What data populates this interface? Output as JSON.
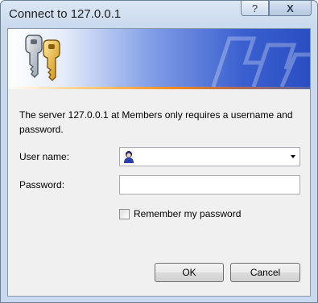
{
  "window": {
    "title": "Connect to 127.0.0.1",
    "help_label": "?",
    "close_label": "X"
  },
  "dialog": {
    "message": "The server 127.0.0.1 at Members only requires a username and password.",
    "username_label": "User name:",
    "username_value": "",
    "password_label": "Password:",
    "password_value": "",
    "remember_label": "Remember my password",
    "remember_checked": false,
    "ok_label": "OK",
    "cancel_label": "Cancel"
  },
  "icons": {
    "banner_left": "keys-icon",
    "banner_right": "network-decoration-icon",
    "username_field": "user-icon",
    "username_dropdown": "dropdown-arrow-icon"
  },
  "colors": {
    "banner_blue": "#2b4fc3",
    "banner_accent_line": "#f38a1a",
    "dialog_background": "#f0f0f0"
  }
}
